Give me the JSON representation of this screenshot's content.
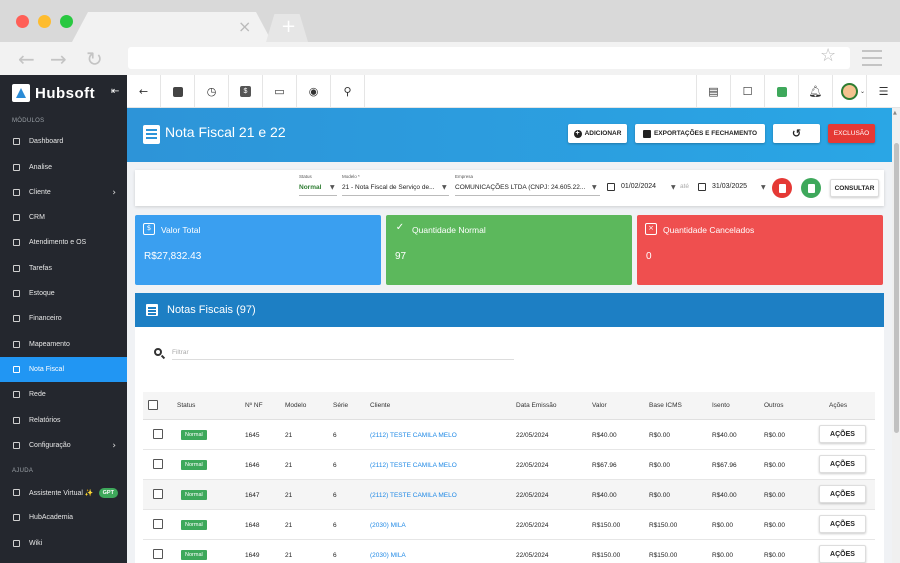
{
  "colors": {
    "primary": "#2196f3",
    "header_gradient_start": "#2d94d8",
    "panel_header": "#1d7fc4",
    "success": "#3ea85b",
    "danger": "#e53935",
    "info_card": "#3a9ff0",
    "normal_card": "#5cb85c",
    "cancel_card": "#ef4f4f",
    "sidebar_bg": "#24272e"
  },
  "brand": {
    "name": "Hubsoft",
    "collapse_icon": "collapse-sidebar-icon"
  },
  "sidebar": {
    "section_modulos": "MÓDULOS",
    "section_ajuda": "AJUDA",
    "items": [
      {
        "label": "Dashboard",
        "icon": "dashboard-icon",
        "has_submenu": false
      },
      {
        "label": "Analise",
        "icon": "analytics-icon",
        "has_submenu": false
      },
      {
        "label": "Cliente",
        "icon": "client-icon",
        "has_submenu": true
      },
      {
        "label": "CRM",
        "icon": "crm-icon",
        "has_submenu": false
      },
      {
        "label": "Atendimento e OS",
        "icon": "service-icon",
        "has_submenu": false
      },
      {
        "label": "Tarefas",
        "icon": "tasks-icon",
        "has_submenu": false
      },
      {
        "label": "Estoque",
        "icon": "stock-icon",
        "has_submenu": false
      },
      {
        "label": "Financeiro",
        "icon": "finance-icon",
        "has_submenu": false
      },
      {
        "label": "Mapeamento",
        "icon": "map-pin-icon",
        "has_submenu": false
      },
      {
        "label": "Nota Fiscal",
        "icon": "invoice-icon",
        "has_submenu": false,
        "active": true
      },
      {
        "label": "Rede",
        "icon": "network-icon",
        "has_submenu": false
      },
      {
        "label": "Relatórios",
        "icon": "reports-icon",
        "has_submenu": false
      },
      {
        "label": "Configuração",
        "icon": "gear-icon",
        "has_submenu": true
      }
    ],
    "help_items": [
      {
        "label": "Assistente Virtual ✨",
        "icon": "android-icon",
        "badge": "GPT"
      },
      {
        "label": "HubAcademia",
        "icon": "youtube-icon"
      },
      {
        "label": "Wiki",
        "icon": "wiki-icon"
      }
    ]
  },
  "toolbar": {
    "left_icons": [
      "back-arrow-icon",
      "contact-card-icon",
      "ticket-icon",
      "dollar-icon",
      "terminal-icon",
      "eye-icon",
      "search-icon"
    ],
    "right_icons": [
      "pdf-file-icon",
      "bot-icon",
      "chat-check-icon",
      "bell-icon",
      "user-avatar-icon",
      "list-menu-icon"
    ]
  },
  "header": {
    "title": "Nota Fiscal 21 e 22",
    "buttons": {
      "add": "ADICIONAR",
      "exports": "EXPORTAÇÕES E FECHAMENTO",
      "history_icon": "history-icon",
      "delete": "EXCLUSÃO"
    }
  },
  "filters": {
    "status_label": "Status",
    "status_value": "Normal",
    "model_label": "Modelo *",
    "model_value": "21 - Nota Fiscal de Serviço de...",
    "company_label": "Empresa",
    "company_value": "COMUNICAÇÕES LTDA (CNPJ: 24.605.22...",
    "date_from": "01/02/2024",
    "date_sep": "até",
    "date_to": "31/03/2025",
    "consult": "CONSULTAR"
  },
  "cards": [
    {
      "title": "Valor Total",
      "value": "R$27,832.43",
      "icon": "dollar-icon"
    },
    {
      "title": "Quantidade Normal",
      "value": "97",
      "icon": "check-icon"
    },
    {
      "title": "Quantidade Cancelados",
      "value": "0",
      "icon": "calendar-x-icon"
    }
  ],
  "panel": {
    "title": "Notas Fiscais (97)",
    "search_placeholder": "Filtrar"
  },
  "table": {
    "columns": [
      "Status",
      "Nº NF",
      "Modelo",
      "Série",
      "Cliente",
      "Data Emissão",
      "Valor",
      "Base ICMS",
      "Isento",
      "Outros",
      "Ações"
    ],
    "rows": [
      {
        "status": "Normal",
        "nf": "1645",
        "modelo": "21",
        "serie": "6",
        "cliente": "(2112) TESTE CAMILA MELO",
        "data": "22/05/2024",
        "valor": "R$40.00",
        "base": "R$0.00",
        "isento": "R$40.00",
        "outros": "R$0.00",
        "acoes": "AÇÕES"
      },
      {
        "status": "Normal",
        "nf": "1646",
        "modelo": "21",
        "serie": "6",
        "cliente": "(2112) TESTE CAMILA MELO",
        "data": "22/05/2024",
        "valor": "R$67.96",
        "base": "R$0.00",
        "isento": "R$67.96",
        "outros": "R$0.00",
        "acoes": "AÇÕES"
      },
      {
        "status": "Normal",
        "nf": "1647",
        "modelo": "21",
        "serie": "6",
        "cliente": "(2112) TESTE CAMILA MELO",
        "data": "22/05/2024",
        "valor": "R$40.00",
        "base": "R$0.00",
        "isento": "R$40.00",
        "outros": "R$0.00",
        "acoes": "AÇÕES"
      },
      {
        "status": "Normal",
        "nf": "1648",
        "modelo": "21",
        "serie": "6",
        "cliente": "(2030) MILA",
        "data": "22/05/2024",
        "valor": "R$150.00",
        "base": "R$150.00",
        "isento": "R$0.00",
        "outros": "R$0.00",
        "acoes": "AÇÕES"
      },
      {
        "status": "Normal",
        "nf": "1649",
        "modelo": "21",
        "serie": "6",
        "cliente": "(2030) MILA",
        "data": "22/05/2024",
        "valor": "R$150.00",
        "base": "R$150.00",
        "isento": "R$0.00",
        "outros": "R$0.00",
        "acoes": "AÇÕES"
      }
    ]
  }
}
